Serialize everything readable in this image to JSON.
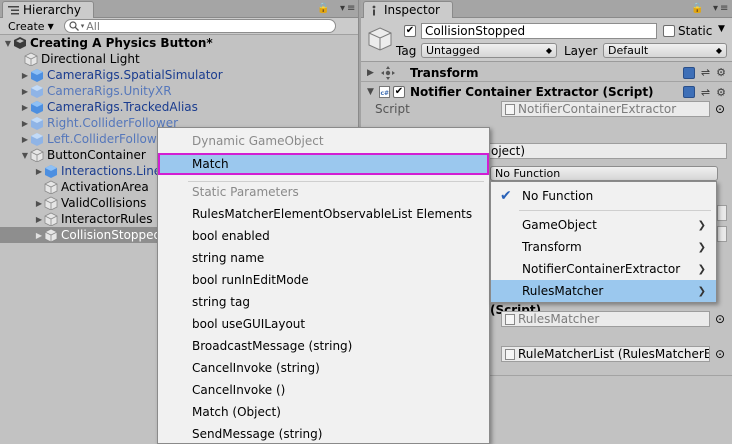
{
  "hierarchy": {
    "tab_title": "Hierarchy",
    "create_label": "Create",
    "search_placeholder": "All",
    "scene_title": "Creating A Physics Button*",
    "items": [
      {
        "label": "Directional Light"
      },
      {
        "label": "CameraRigs.SpatialSimulator"
      },
      {
        "label": "CameraRigs.UnityXR"
      },
      {
        "label": "CameraRigs.TrackedAlias"
      },
      {
        "label": "Right.ColliderFollower"
      },
      {
        "label": "Left.ColliderFollower"
      },
      {
        "label": "ButtonContainer"
      },
      {
        "label": "Interactions.Line"
      },
      {
        "label": "ActivationArea"
      },
      {
        "label": "ValidCollisions"
      },
      {
        "label": "InteractorRules"
      },
      {
        "label": "CollisionStopped"
      }
    ]
  },
  "inspector": {
    "tab_title": "Inspector",
    "object_name": "CollisionStopped",
    "static_label": "Static",
    "tag_label": "Tag",
    "tag_value": "Untagged",
    "layer_label": "Layer",
    "layer_value": "Default",
    "transform_title": "Transform",
    "component_title": "Notifier Container Extractor (Script)",
    "script_label": "Script",
    "script_value": "NotifierContainerExtractor",
    "partial_object": "oject)",
    "function_dropdown": "No Function",
    "partial_script": "(Script)",
    "rules_matcher_field": "RulesMatcher",
    "rule_list_field": "RuleMatcherList (RulesMatcherEle"
  },
  "context_menu": {
    "dynamic_header": "Dynamic GameObject",
    "match_label": "Match",
    "static_header": "Static Parameters",
    "items": [
      "RulesMatcherElementObservableList Elements",
      "bool enabled",
      "string name",
      "bool runInEditMode",
      "string tag",
      "bool useGUILayout",
      "BroadcastMessage (string)",
      "CancelInvoke (string)",
      "CancelInvoke ()",
      "Match (Object)",
      "SendMessage (string)"
    ]
  },
  "submenu": {
    "items": [
      {
        "label": "No Function",
        "checked": true
      },
      {
        "label": "GameObject"
      },
      {
        "label": "Transform"
      },
      {
        "label": "NotifierContainerExtractor"
      },
      {
        "label": "RulesMatcher"
      }
    ]
  },
  "icons": {
    "hierarchy": "hierarchy-tab-icon",
    "inspector": "inspector-tab-icon",
    "gameobject": "cube-icon",
    "checkmark": "checkmark-icon",
    "chevron": "chevron-right-icon",
    "gear": "gear-icon",
    "book": "help-book-icon"
  },
  "colors": {
    "selection": "#9bc8ee",
    "highlight_border": "#d21ed2",
    "prefab_blue": "#1a3c8f",
    "missing_blue": "#5577bb"
  }
}
